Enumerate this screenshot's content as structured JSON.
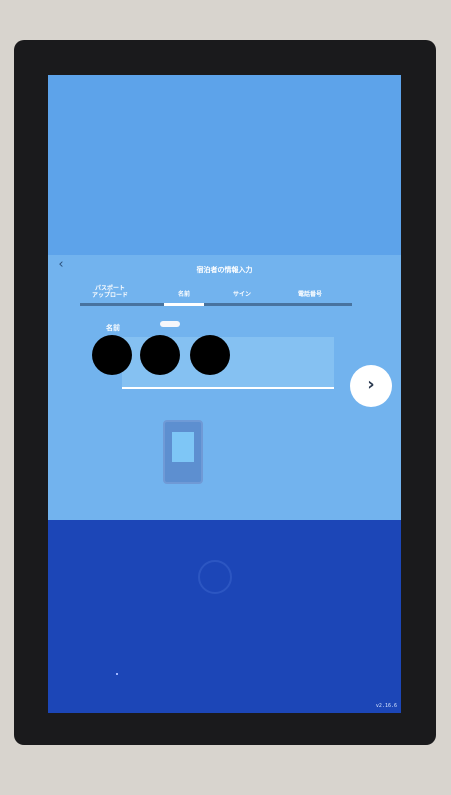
{
  "screen": {
    "title": "宿泊者の情報入力",
    "back_icon": "‹",
    "steps": [
      {
        "label": "パスポート\nアップロード"
      },
      {
        "label": "名前"
      },
      {
        "label": "サイン"
      },
      {
        "label": "電話番号"
      }
    ],
    "active_step_index": 1,
    "field_label": "名前",
    "name_value": "",
    "next_icon": "›",
    "version": "v2.16.6"
  },
  "colors": {
    "screen_blue": "#5da3ea",
    "panel_blue": "#72b3ee",
    "footer_blue": "#1c46b7",
    "white": "#ffffff"
  }
}
